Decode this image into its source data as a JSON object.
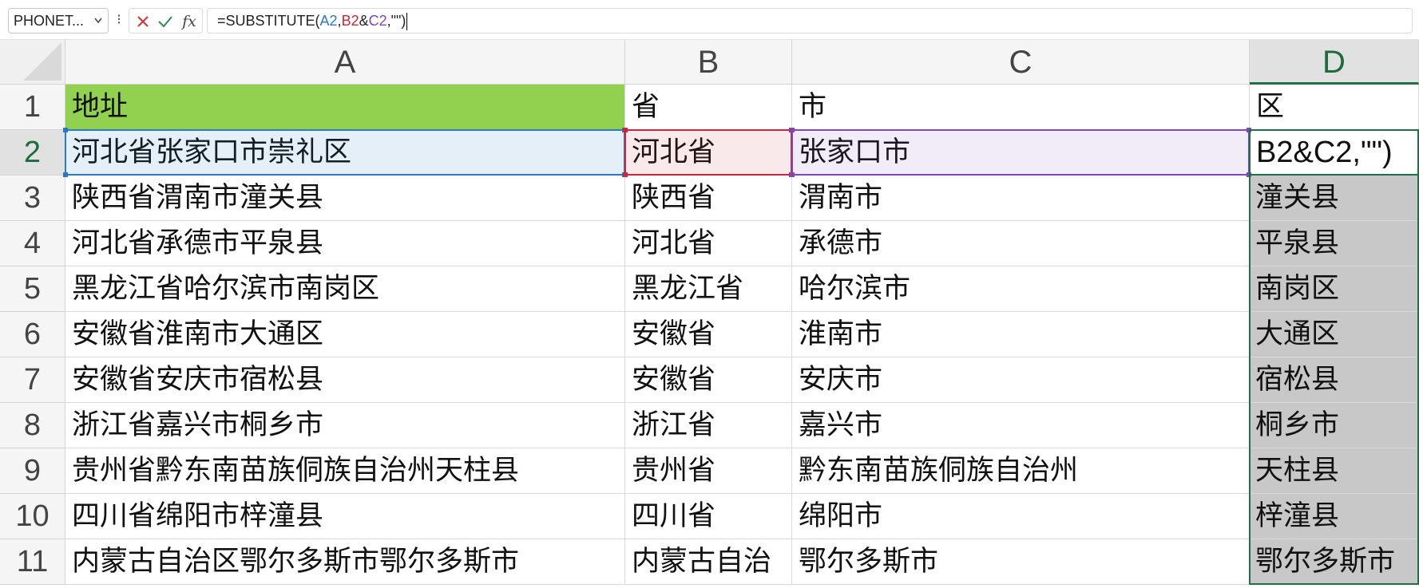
{
  "formula_bar": {
    "name_box": "PHONET...",
    "name_box_chevron": "chevron-down-icon",
    "more": "⁝",
    "cancel_icon": "close-icon",
    "enter_icon": "check-icon",
    "fx_label": "fx",
    "formula_prefix": "=SUBSTITUTE(",
    "ref_a": "A2",
    "sep1": ",",
    "ref_b": "B2",
    "amp": "&",
    "ref_c": "C2",
    "formula_suffix": ",\"\")",
    "colors": {
      "ref_a": "#2d78c5",
      "ref_b": "#c6283d",
      "ref_c": "#7e48b6"
    }
  },
  "columns": [
    "A",
    "B",
    "C",
    "D"
  ],
  "active_column": "D",
  "rows": [
    "1",
    "2",
    "3",
    "4",
    "5",
    "6",
    "7",
    "8",
    "9",
    "10",
    "11"
  ],
  "active_row": "2",
  "cells": {
    "A": [
      "地址",
      "河北省张家口市崇礼区",
      "陕西省渭南市潼关县",
      "河北省承德市平泉县",
      "黑龙江省哈尔滨市南岗区",
      "安徽省淮南市大通区",
      "安徽省安庆市宿松县",
      "浙江省嘉兴市桐乡市",
      "贵州省黔东南苗族侗族自治州天柱县",
      "四川省绵阳市梓潼县",
      "内蒙古自治区鄂尔多斯市鄂尔多斯市"
    ],
    "B": [
      "省",
      "河北省",
      "陕西省",
      "河北省",
      "黑龙江省",
      "安徽省",
      "安徽省",
      "浙江省",
      "贵州省",
      "四川省",
      "内蒙古自治"
    ],
    "C": [
      "市",
      "张家口市",
      "渭南市",
      "承德市",
      "哈尔滨市",
      "淮南市",
      "安庆市",
      "嘉兴市",
      "黔东南苗族侗族自治州",
      "绵阳市",
      "鄂尔多斯市"
    ],
    "D": [
      "区",
      "B2&C2,\"\")",
      "潼关县",
      "平泉县",
      "南岗区",
      "大通区",
      "宿松县",
      "桐乡市",
      "天柱县",
      "梓潼县",
      "鄂尔多斯市"
    ]
  },
  "colors": {
    "header_fill_a1": "#92d050",
    "selection": "#1e7145",
    "selected_range_fill": "#c8c8c8"
  }
}
